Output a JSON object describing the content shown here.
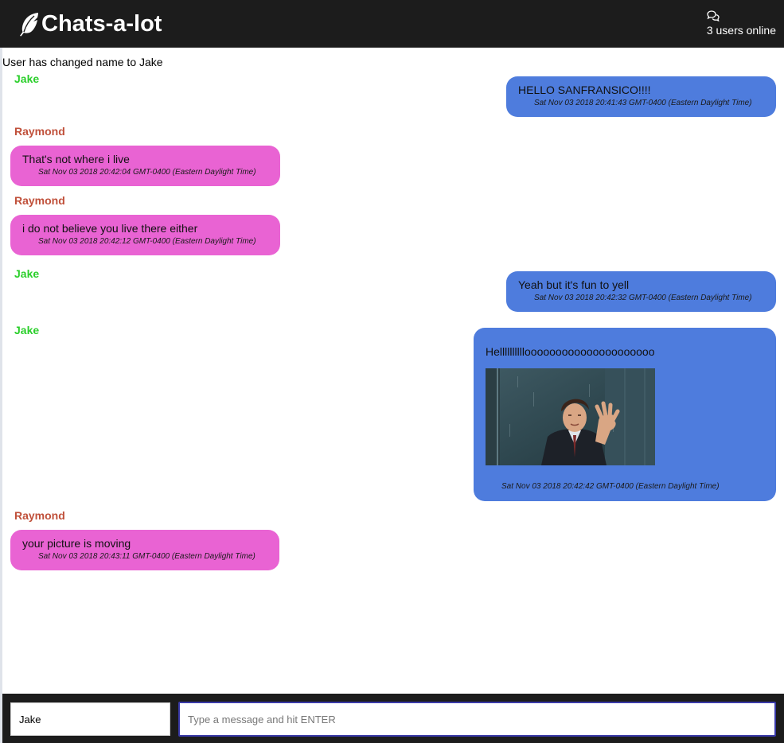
{
  "header": {
    "title": "Chats-a-lot",
    "logo_icon": "feather-icon",
    "online_icon": "chat-bubbles-icon",
    "online_text": "3 users online",
    "background": "#1c1c1c"
  },
  "feed": {
    "system_message": "User has changed name to Jake",
    "messages": [
      {
        "sender": "Jake",
        "text": "HELLO SANFRANSICO!!!!",
        "time": "Sat Nov 03 2018 20:41:43 GMT-0400 (Eastern Daylight Time)",
        "color": "#4e7cdd"
      },
      {
        "sender": "Raymond",
        "text": "That's not where i live",
        "time": "Sat Nov 03 2018 20:42:04 GMT-0400 (Eastern Daylight Time)",
        "color": "#e963d3"
      },
      {
        "sender": "Raymond",
        "text": "i do not believe you live there either",
        "time": "Sat Nov 03 2018 20:42:12 GMT-0400 (Eastern Daylight Time)",
        "color": "#e963d3"
      },
      {
        "sender": "Jake",
        "text": "Yeah but it's fun to yell",
        "time": "Sat Nov 03 2018 20:42:32 GMT-0400 (Eastern Daylight Time)",
        "color": "#4e7cdd"
      },
      {
        "sender": "Jake",
        "text": "Hellllllllllooooooooooooooooooooo",
        "image": "animated-gif-man-waving",
        "time": "Sat Nov 03 2018 20:42:42 GMT-0400 (Eastern Daylight Time)",
        "color": "#4e7cdd"
      },
      {
        "sender": "Raymond",
        "text": "your picture is moving",
        "time": "Sat Nov 03 2018 20:43:11 GMT-0400 (Eastern Daylight Time)",
        "color": "#e963d3"
      }
    ],
    "sender_colors": {
      "Jake": "#2bcf2b",
      "Raymond": "#c0503a"
    }
  },
  "composer": {
    "name_value": "Jake",
    "message_placeholder": "Type a message and hit ENTER",
    "message_value": ""
  }
}
